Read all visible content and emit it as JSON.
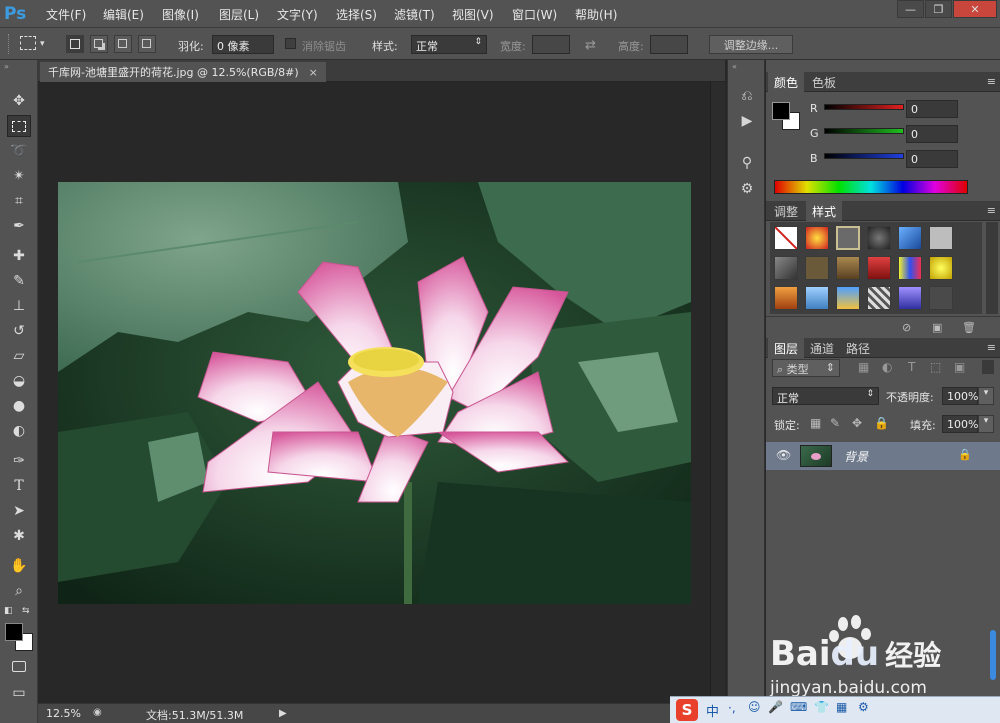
{
  "app": {
    "logo": "Ps"
  },
  "menu": [
    "文件(F)",
    "编辑(E)",
    "图像(I)",
    "图层(L)",
    "文字(Y)",
    "选择(S)",
    "滤镜(T)",
    "视图(V)",
    "窗口(W)",
    "帮助(H)"
  ],
  "window_buttons": {
    "minimize": "—",
    "restore": "❐",
    "close": "✕"
  },
  "options": {
    "feather_label": "羽化:",
    "feather_value": "0 像素",
    "antialias_label": "消除锯齿",
    "style_label": "样式:",
    "style_value": "正常",
    "width_label": "宽度:",
    "height_label": "高度:",
    "refine_edge": "调整边缘..."
  },
  "document": {
    "tab_title": "千库网-池塘里盛开的荷花.jpg @ 12.5%(RGB/8#)",
    "close_glyph": "×"
  },
  "status": {
    "zoom": "12.5%",
    "doc": "文档:51.3M/51.3M"
  },
  "color_panel": {
    "tabs": [
      "颜色",
      "色板"
    ],
    "channels": [
      {
        "label": "R",
        "value": "0",
        "color": "#e02020"
      },
      {
        "label": "G",
        "value": "0",
        "color": "#20c020"
      },
      {
        "label": "B",
        "value": "0",
        "color": "#2040e0"
      }
    ]
  },
  "styles_panel": {
    "tabs": [
      "调整",
      "样式"
    ]
  },
  "layers_panel": {
    "tabs": [
      "图层",
      "通道",
      "路径"
    ],
    "filter_label": "类型",
    "blend_mode": "正常",
    "opacity_label": "不透明度:",
    "opacity_value": "100%",
    "lock_label": "锁定:",
    "fill_label": "填充:",
    "fill_value": "100%",
    "layer_name": "背景"
  },
  "watermark": {
    "brand": "Bai",
    "brand2": "du",
    "cn": "经验",
    "url": "jingyan.baidu.com"
  },
  "taskbar": {
    "ime_logo": "S",
    "ime_lang": "中"
  },
  "colors": {
    "accent": "#3c9ce0",
    "panel": "#535353",
    "dark": "#282828",
    "layer_selected": "#6e7a8c"
  }
}
